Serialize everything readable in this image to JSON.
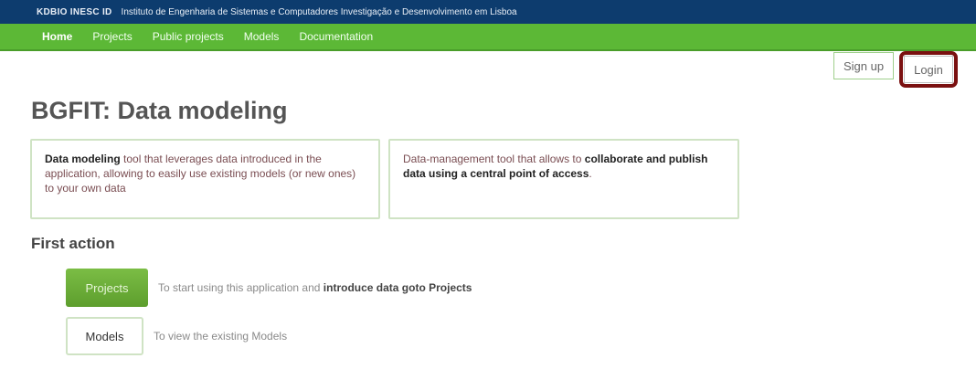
{
  "topbar": {
    "short_name": "KDBIO INESC ID",
    "institution": "Instituto de Engenharia de Sistemas e Computadores Investigação e Desenvolvimento em Lisboa"
  },
  "nav": {
    "items": [
      "Home",
      "Projects",
      "Public projects",
      "Models",
      "Documentation"
    ],
    "active": "Home"
  },
  "auth": {
    "signup_label": "Sign up",
    "login_label": "Login"
  },
  "page": {
    "title": "BGFIT: Data modeling"
  },
  "cards": [
    {
      "bold_prefix": "Data modeling",
      "text": " tool that leverages data introduced in the application, allowing to easily use existing models (or new ones) to your own data"
    },
    {
      "text": "Data-management tool that allows to ",
      "bold_suffix": "collaborate and publish data using a central point of access",
      "tail": "."
    }
  ],
  "first_action": {
    "title": "First action",
    "actions": [
      {
        "button_label": "Projects",
        "desc_prefix": "To start using this application and ",
        "desc_bold": "introduce data goto Projects"
      },
      {
        "button_label": "Models",
        "desc": "To view the existing Models"
      }
    ]
  },
  "colors": {
    "topbar_bg": "#0d3c6e",
    "navbar_bg": "#5cb836",
    "highlight_border": "#7a1010"
  }
}
